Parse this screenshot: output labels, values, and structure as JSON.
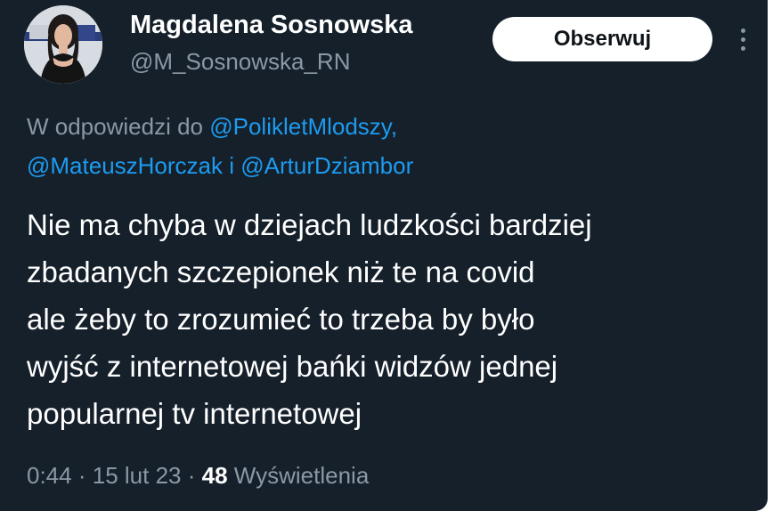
{
  "author": {
    "name": "Magdalena Sosnowska",
    "handle": "@M_Sosnowska_RN"
  },
  "follow_button": {
    "label": "Obserwuj"
  },
  "more_button": {
    "icon": "more-vertical-icon"
  },
  "reply_context": {
    "prefix": "W odpowiedzi do",
    "mention_1": "@PolikletMlodszy,",
    "mention_2": "@MateuszHorczak",
    "conjunction": "i",
    "mention_3": "@ArturDziambor"
  },
  "tweet": {
    "lines": [
      "Nie ma chyba w dziejach ludzkości bardziej",
      "zbadanych szczepionek niż te na covid",
      "ale żeby to zrozumieć to trzeba by było",
      "wyjść z internetowej bańki widzów jednej",
      "popularnej tv internetowej"
    ]
  },
  "meta": {
    "time": "0:44",
    "separator": "·",
    "date": "15 lut 23",
    "views_count": "48",
    "views_label": "Wyświetlenia"
  },
  "colors": {
    "background": "#15202b",
    "text_primary": "#ffffff",
    "text_secondary": "#8b98a5",
    "link": "#1d9bf0"
  }
}
